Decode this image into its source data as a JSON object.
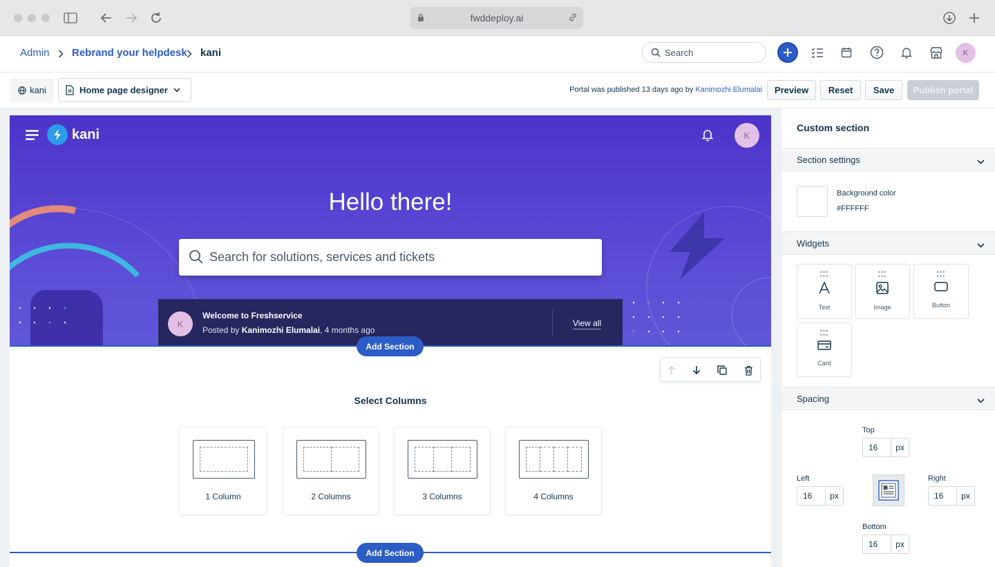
{
  "browser": {
    "url": "fwddeploy.ai"
  },
  "header": {
    "breadcrumbs": [
      "Admin",
      "Rebrand your helpdesk",
      "kani"
    ],
    "search_placeholder": "Search",
    "avatar_initial": "K"
  },
  "toolbar": {
    "portal_name": "kani",
    "designer_label": "Home page designer",
    "published_text": "Portal was published 13 days ago by",
    "published_by": "Kanimozhi Elumalai",
    "preview_label": "Preview",
    "reset_label": "Reset",
    "save_label": "Save",
    "publish_label": "Publish portal"
  },
  "hero": {
    "brand": "kani",
    "avatar_initial": "K",
    "title": "Hello there!",
    "search_placeholder": "Search for solutions, services and tickets",
    "announcement": {
      "avatar_initial": "K",
      "title": "Welcome to Freshservice",
      "posted_prefix": "Posted by ",
      "author": "Kanimozhi Elumalai",
      "time": ", 4 months ago",
      "view_all": "View all"
    },
    "colors": {
      "background": "#5543cf",
      "accent_bar": "#2c5cc5"
    }
  },
  "canvas": {
    "add_section_label": "Add Section",
    "select_columns_title": "Select Columns",
    "column_options": [
      {
        "label": "1 Column",
        "count": 1
      },
      {
        "label": "2 Columns",
        "count": 2
      },
      {
        "label": "3 Columns",
        "count": 3
      },
      {
        "label": "4 Columns",
        "count": 4
      }
    ]
  },
  "panel": {
    "title": "Custom section",
    "section_settings": {
      "heading": "Section settings",
      "bg_label": "Background color",
      "bg_value": "#FFFFFF"
    },
    "widgets": {
      "heading": "Widgets",
      "items": [
        {
          "label": "Text",
          "icon": "text-icon"
        },
        {
          "label": "Image",
          "icon": "image-icon"
        },
        {
          "label": "Button",
          "icon": "button-icon"
        },
        {
          "label": "Card",
          "icon": "card-icon"
        }
      ]
    },
    "spacing": {
      "heading": "Spacing",
      "top_label": "Top",
      "top_value": "16",
      "left_label": "Left",
      "left_value": "16",
      "right_label": "Right",
      "right_value": "16",
      "bottom_label": "Bottom",
      "bottom_value": "16",
      "unit": "px"
    }
  }
}
